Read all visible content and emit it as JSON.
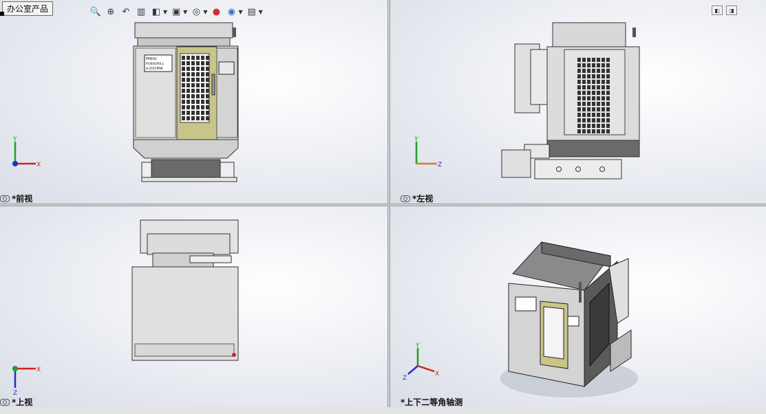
{
  "document_tab": "办公室产品",
  "views": {
    "front": "*前视",
    "left": "*左视",
    "top": "*上视",
    "iso": "*上下二等角轴测"
  },
  "machine_label": {
    "line1": "FANUC",
    "line2": "ROBODRILL",
    "line3": "α-D21MiA"
  },
  "triad_labels": {
    "x": "X",
    "y": "Y",
    "z": "Z"
  },
  "hud_icons": [
    "zoom-to-fit-icon",
    "zoom-to-area-icon",
    "previous-view-icon",
    "section-view-icon",
    "view-orientation-icon",
    "display-style-icon",
    "hide-show-items-icon",
    "edit-appearance-icon",
    "apply-scene-icon",
    "view-settings-icon"
  ],
  "colors": {
    "door": "#c8c48a",
    "body": "#d8d8d8",
    "dark": "#555555",
    "axis_x": "#d02020",
    "axis_y": "#20a020",
    "axis_z": "#2030c0"
  }
}
